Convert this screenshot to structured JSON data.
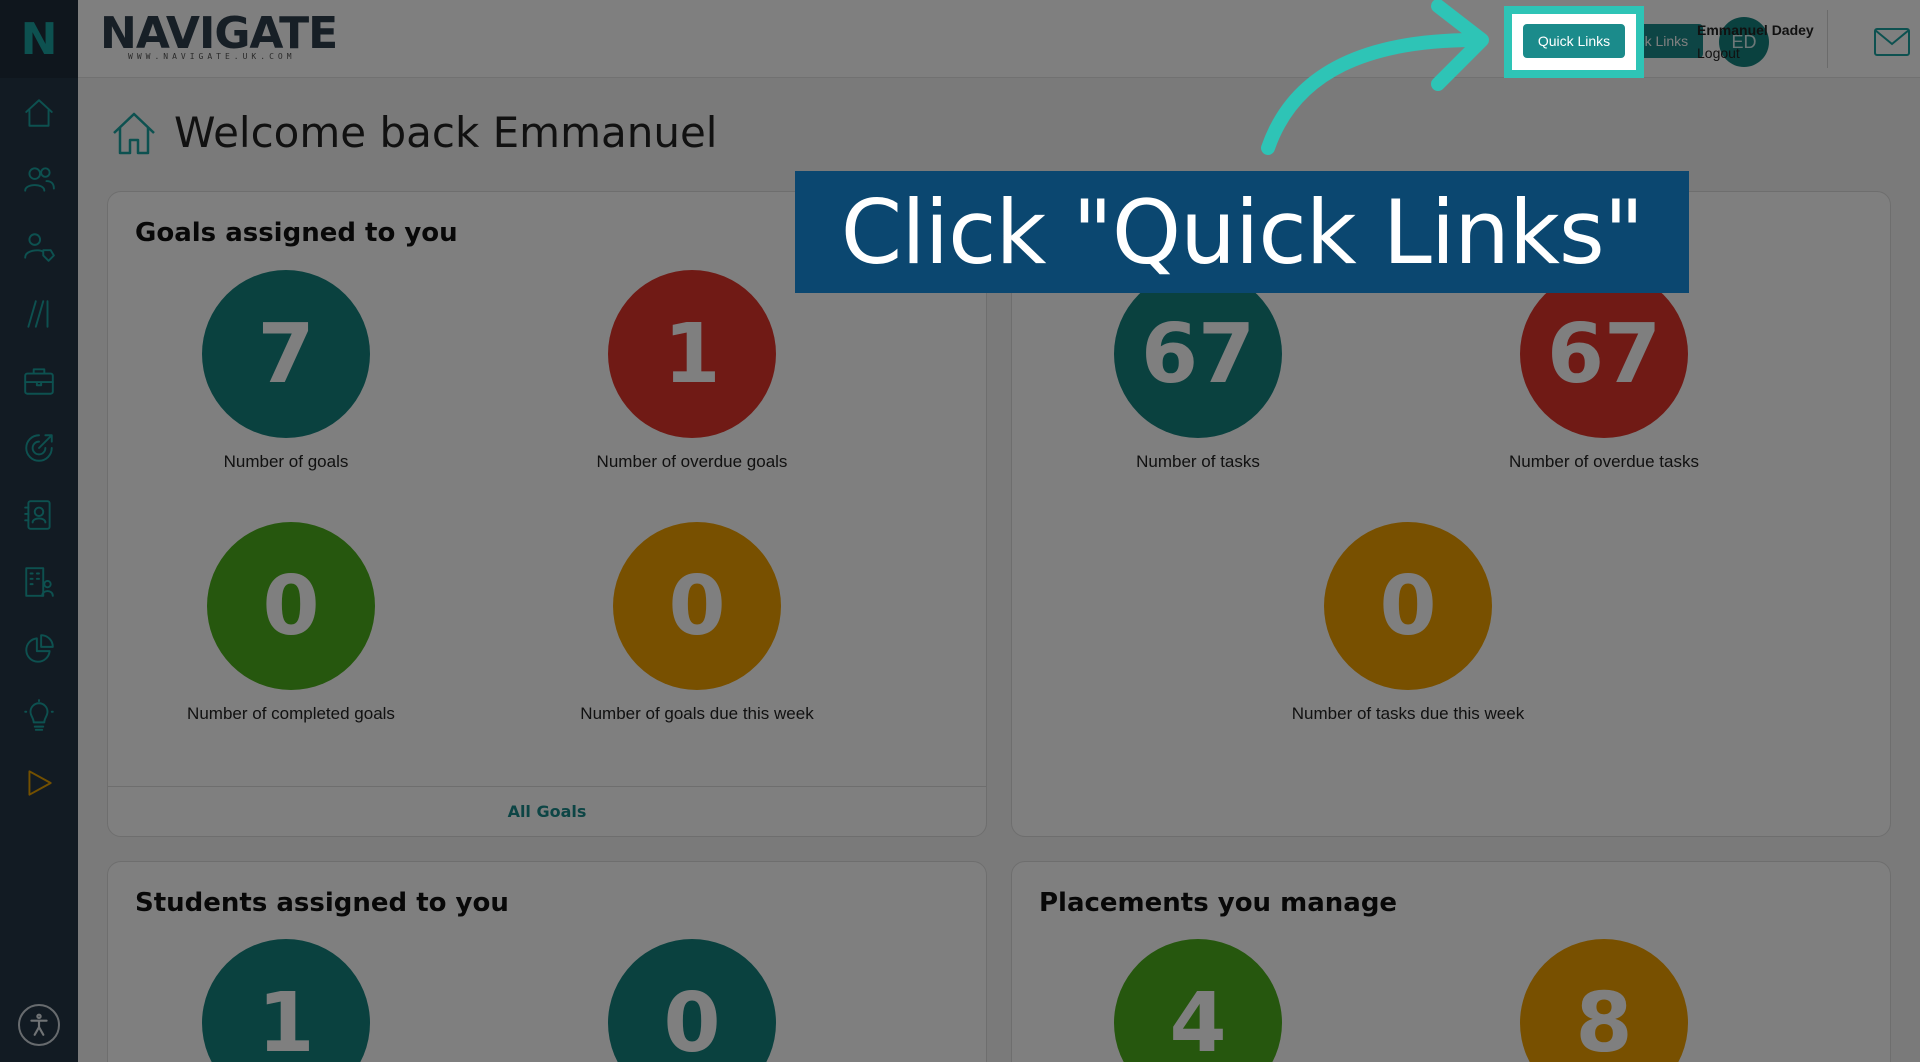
{
  "app": {
    "brand": "NAVIGATE",
    "brand_url": "WWW.NAVIGATE.UK.COM",
    "sidebar_logo": "N"
  },
  "header": {
    "quick_links_label": "Quick Links",
    "avatar_initials": "ED",
    "user_name": "Emmanuel Dadey",
    "logout_label": "Logout"
  },
  "sidebar": {
    "items": [
      {
        "icon": "home-icon"
      },
      {
        "icon": "users-icon"
      },
      {
        "icon": "user-tag-icon"
      },
      {
        "icon": "slashes-icon"
      },
      {
        "icon": "briefcase-icon"
      },
      {
        "icon": "target-icon"
      },
      {
        "icon": "contact-card-icon"
      },
      {
        "icon": "building-user-icon"
      },
      {
        "icon": "pie-chart-icon"
      },
      {
        "icon": "lightbulb-icon"
      },
      {
        "icon": "play-icon"
      }
    ]
  },
  "page": {
    "title": "Welcome back Emmanuel"
  },
  "goals": {
    "title": "Goals assigned to you",
    "stats": [
      {
        "value": "7",
        "label": "Number of goals",
        "color": "#14827f"
      },
      {
        "value": "1",
        "label": "Number of overdue goals",
        "color": "#e0352b"
      },
      {
        "value": "0",
        "label": "Number of completed goals",
        "color": "#4caf1c"
      },
      {
        "value": "0",
        "label": "Number of goals due this week",
        "color": "#f0a000"
      }
    ],
    "footer_link": "All Goals"
  },
  "tasks": {
    "stats": [
      {
        "value": "67",
        "label": "Number of tasks",
        "color": "#14827f"
      },
      {
        "value": "67",
        "label": "Number of overdue tasks",
        "color": "#e0352b"
      },
      {
        "value": "0",
        "label": "Number of tasks due this week",
        "color": "#f0a000"
      }
    ]
  },
  "students": {
    "title": "Students assigned to you",
    "stats": [
      {
        "value": "1",
        "color": "#14827f"
      },
      {
        "value": "0",
        "color": "#14827f"
      }
    ]
  },
  "placements": {
    "title": "Placements you manage",
    "stats": [
      {
        "value": "4",
        "color": "#4caf1c"
      },
      {
        "value": "8",
        "color": "#f0a000"
      }
    ]
  },
  "overlay": {
    "callout_text": "Click \"Quick Links\""
  },
  "colors": {
    "accent": "#1aa3a0",
    "callout_bg": "#0b4770",
    "highlight": "#2ec4b6"
  }
}
